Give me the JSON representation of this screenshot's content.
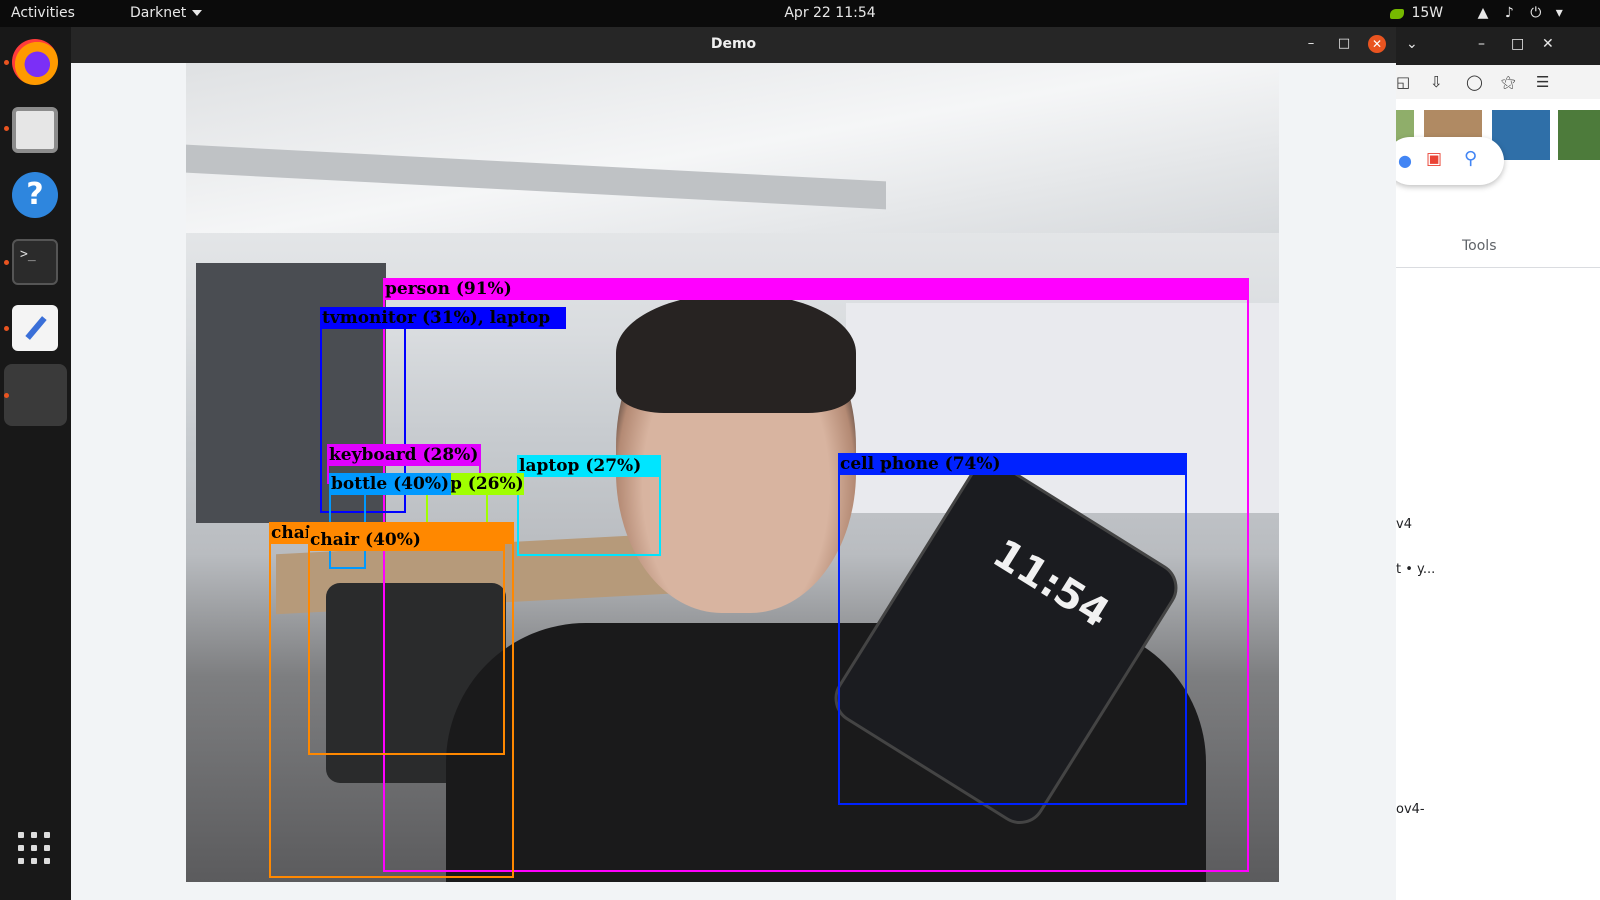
{
  "topbar": {
    "activities": "Activities",
    "app_name": "Darknet",
    "clock": "Apr 22  11:54",
    "power_label": "15W",
    "icons": [
      "nvidia-icon",
      "wifi-icon",
      "volume-icon",
      "power-icon",
      "chevron-down-icon"
    ]
  },
  "dock": {
    "apps": [
      "Firefox",
      "Files",
      "Help",
      "Terminal",
      "Text Editor",
      "Darknet"
    ],
    "terminal_glyph": ">_"
  },
  "demo_window": {
    "title": "Demo",
    "minimize": "–",
    "maximize": "□",
    "close": "✕"
  },
  "detections": [
    {
      "label": "person (91%)",
      "color": "#ff00ff"
    },
    {
      "label": "tvmonitor (31%), laptop",
      "color": "#0000ff"
    },
    {
      "label": "keyboard (28%)",
      "color": "#e100ff"
    },
    {
      "label": "laptop (27%)",
      "color": "#00e5ff"
    },
    {
      "label": "bottle (40%)",
      "color": "#0099ff"
    },
    {
      "label": "p (26%)",
      "color": "#a0ff00"
    },
    {
      "label": "cell phone (74%)",
      "color": "#0022ff"
    },
    {
      "label": "chair (40%)",
      "color": "#ff8800"
    },
    {
      "label": "chai",
      "color": "#ff8800"
    }
  ],
  "phone_screen_time": "11:54",
  "browser": {
    "tools": "Tools",
    "results": [
      "v4",
      "t • y...",
      "ov4-"
    ],
    "controls": {
      "minimize": "–",
      "maximize": "□",
      "close": "✕"
    }
  }
}
